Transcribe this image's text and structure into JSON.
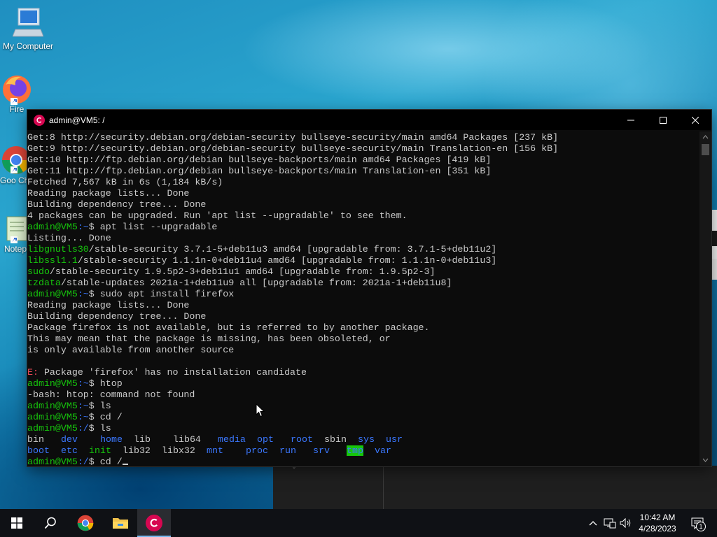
{
  "desktop": {
    "icons": [
      {
        "label": "My Computer"
      },
      {
        "label": "Fire"
      },
      {
        "label": "Goo Chro"
      },
      {
        "label": "Notep"
      }
    ]
  },
  "terminal": {
    "title": "admin@VM5: /",
    "prompt_user": "admin@VM5",
    "lines": {
      "l1": "Get:8 http://security.debian.org/debian-security bullseye-security/main amd64 Packages [237 kB]",
      "l2": "Get:9 http://security.debian.org/debian-security bullseye-security/main Translation-en [156 kB]",
      "l3": "Get:10 http://ftp.debian.org/debian bullseye-backports/main amd64 Packages [419 kB]",
      "l4": "Get:11 http://ftp.debian.org/debian bullseye-backports/main Translation-en [351 kB]",
      "l5": "Fetched 7,567 kB in 6s (1,184 kB/s)",
      "l6": "Reading package lists... Done",
      "l7": "Building dependency tree... Done",
      "l8": "4 packages can be upgraded. Run 'apt list --upgradable' to see them.",
      "cmd1": "$ apt list --upgradable",
      "l10": "Listing... Done",
      "pkg1_name": "libgnutls30",
      "pkg1_rest": "/stable-security 3.7.1-5+deb11u3 amd64 [upgradable from: 3.7.1-5+deb11u2]",
      "pkg2_name": "libssl1.1",
      "pkg2_rest": "/stable-security 1.1.1n-0+deb11u4 amd64 [upgradable from: 1.1.1n-0+deb11u3]",
      "pkg3_name": "sudo",
      "pkg3_rest": "/stable-security 1.9.5p2-3+deb11u1 amd64 [upgradable from: 1.9.5p2-3]",
      "pkg4_name": "tzdata",
      "pkg4_rest": "/stable-updates 2021a-1+deb11u9 all [upgradable from: 2021a-1+deb11u8]",
      "cmd2": "$ sudo apt install firefox",
      "l17": "Reading package lists... Done",
      "l18": "Building dependency tree... Done",
      "l19": "Package firefox is not available, but is referred to by another package.",
      "l20": "This may mean that the package is missing, has been obsoleted, or",
      "l21": "is only available from another source",
      "err_prefix": "E:",
      "err_msg": " Package 'firefox' has no installation candidate",
      "cmd3": "$ htop",
      "l25": "-bash: htop: command not found",
      "cmd4": "$ ls",
      "cmd5": "$ cd /",
      "cmd6": "$ ls",
      "cmd7": "$ cd /"
    },
    "path_home": ":~",
    "path_root": ":/",
    "ls_row1": [
      "bin",
      "dev",
      "home",
      "lib",
      "lib64",
      "media",
      "opt",
      "root",
      "sbin",
      "sys",
      "usr"
    ],
    "ls_row2": [
      "boot",
      "etc",
      "init",
      "lib32",
      "libx32",
      "mnt",
      "proc",
      "run",
      "srv",
      "tmp",
      "var"
    ]
  },
  "taskbar": {
    "time": "10:42 AM",
    "date": "4/28/2023",
    "notification_count": "1"
  }
}
